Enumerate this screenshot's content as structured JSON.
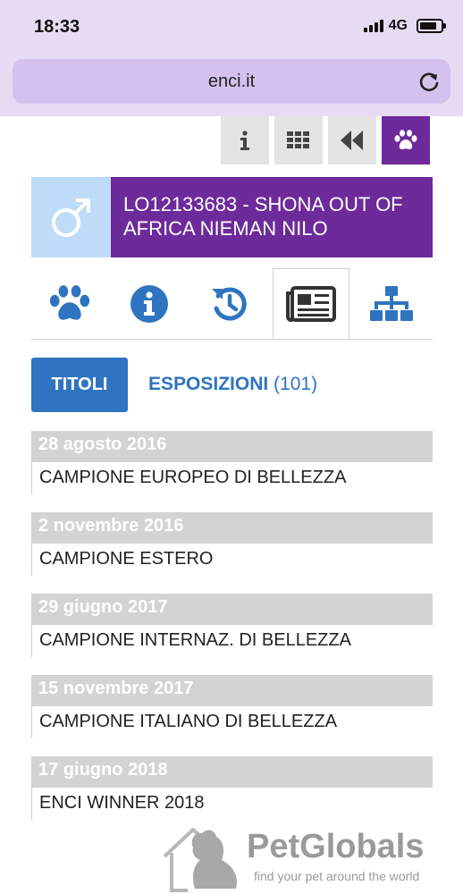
{
  "status": {
    "time": "18:33",
    "network": "4G"
  },
  "browser": {
    "url": "enci.it"
  },
  "top_icons": [
    "info-icon",
    "grid-icon",
    "rewind-icon",
    "paw-icon"
  ],
  "dog": {
    "gender_icon": "male-symbol-icon",
    "name": "LO12133683 - SHONA OUT OF AFRICA NIEMAN NILO"
  },
  "tabs": [
    "paw-icon",
    "info-circle-icon",
    "history-icon",
    "newspaper-icon",
    "pedigree-tree-icon"
  ],
  "subtabs": {
    "titoli": "TITOLI",
    "esposizioni": "ESPOSIZIONI",
    "esposizioni_count": "(101)"
  },
  "titles": [
    {
      "date": "28 agosto 2016",
      "title": "CAMPIONE EUROPEO DI BELLEZZA"
    },
    {
      "date": "2 novembre 2016",
      "title": "CAMPIONE ESTERO"
    },
    {
      "date": "29 giugno 2017",
      "title": "CAMPIONE INTERNAZ. DI BELLEZZA"
    },
    {
      "date": "15 novembre 2017",
      "title": "CAMPIONE ITALIANO DI BELLEZZA"
    },
    {
      "date": "17 giugno 2018",
      "title": "ENCI WINNER 2018"
    }
  ],
  "watermark": {
    "brand": "PetGlobals",
    "tagline": "find your pet around the world"
  },
  "colors": {
    "purple": "#6d2a9b",
    "blue": "#2f74c0",
    "light_blue": "#bedcf7",
    "browser_bg": "#e7dbf4"
  }
}
